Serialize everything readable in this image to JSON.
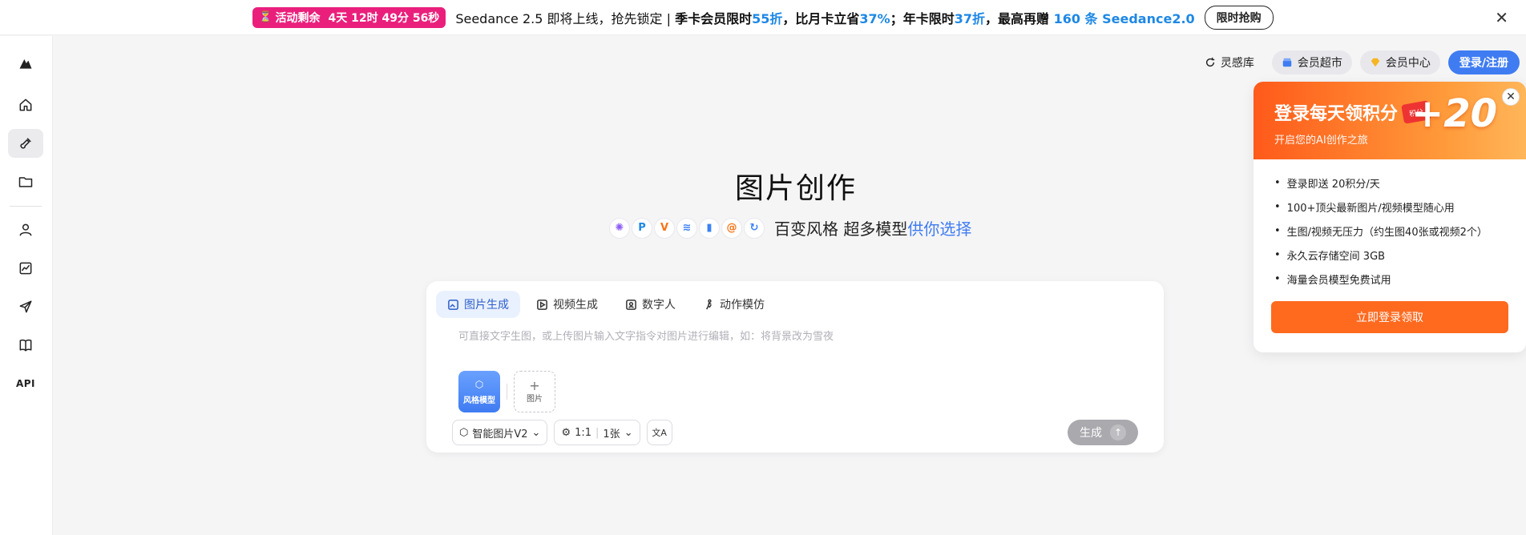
{
  "promo": {
    "timer_label": "活动剩余",
    "timer_value": "4天 12时 49分 56秒",
    "message_prefix": "Seedance 2.5 即将上线，抢先锁定 | ",
    "season_label": "季卡会员限时",
    "season_value": "55折",
    "month_label": "，比月卡立省",
    "month_value": "37%",
    "year_label": "；年卡限时",
    "year_value": "37折",
    "gift_label": "，最高再赠 ",
    "gift_value": "160 条 Seedance2.0",
    "cta": "限时抢购"
  },
  "sidebar": {
    "items": [
      {
        "name": "logo",
        "icon": "logo-icon"
      },
      {
        "name": "home",
        "icon": "home-icon"
      },
      {
        "name": "create",
        "icon": "brush-icon",
        "active": true
      },
      {
        "name": "folder",
        "icon": "folder-icon"
      },
      {
        "name": "user",
        "icon": "user-icon"
      },
      {
        "name": "chart",
        "icon": "chart-icon"
      },
      {
        "name": "send",
        "icon": "send-icon"
      },
      {
        "name": "book",
        "icon": "book-icon"
      }
    ],
    "api_label": "API"
  },
  "top_actions": {
    "inspiration": "灵感库",
    "market": "会员超市",
    "member_center": "会员中心",
    "login": "登录/注册"
  },
  "hero": {
    "title": "图片创作",
    "subtitle_dark": "百变风格 超多模型",
    "subtitle_blue": "供你选择"
  },
  "composer": {
    "tabs": [
      {
        "label": "图片生成",
        "active": true
      },
      {
        "label": "视频生成"
      },
      {
        "label": "数字人"
      },
      {
        "label": "动作模仿"
      }
    ],
    "placeholder": "可直接文字生图，或上传图片输入文字指令对图片进行编辑，如：将背景改为雪夜",
    "style_chip": "风格模型",
    "image_chip": "图片",
    "model_select": "智能图片V2",
    "ratio": "1:1",
    "count": "1张",
    "generate": "生成"
  },
  "login_panel": {
    "title": "登录每天领积分",
    "subtitle": "开启您的AI创作之旅",
    "badge": "+20",
    "card_text": "积分",
    "benefits": [
      "登录即送 20积分/天",
      "100+顶尖最新图片/视频模型随心用",
      "生图/视频无压力（约生图40张或视频2个）",
      "永久云存储空间 3GB",
      "海量会员模型免费试用"
    ],
    "button": "立即登录领取"
  }
}
